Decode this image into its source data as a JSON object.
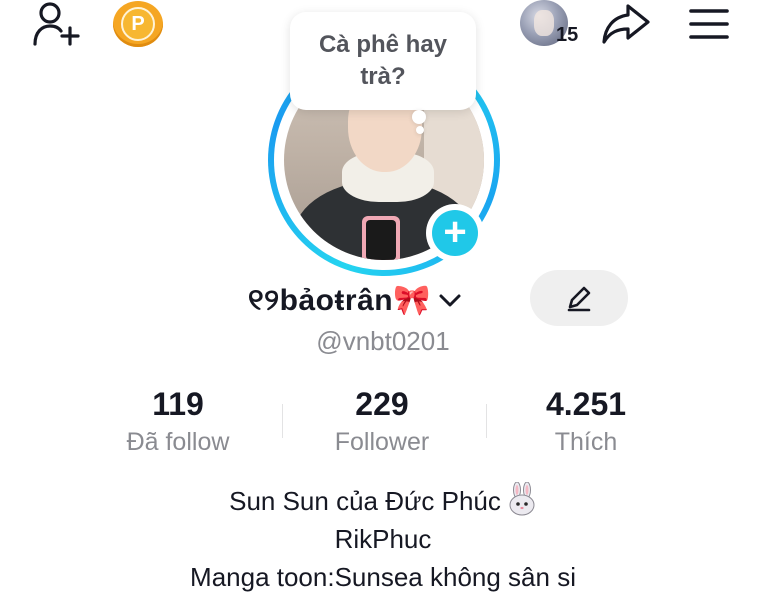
{
  "topbar": {
    "add_friend_icon": "add-user-icon",
    "points_label": "P",
    "visitor_count": "15",
    "share_icon": "share-arrow-icon",
    "menu_icon": "hamburger-menu-icon"
  },
  "note_bubble": {
    "line1": "Cà phê hay",
    "line2": "trà?"
  },
  "profile": {
    "display_name": "୧୨bảoŧrân🎀",
    "username": "@vnbt0201"
  },
  "stats": [
    {
      "value": "119",
      "label": "Đã follow"
    },
    {
      "value": "229",
      "label": "Follower"
    },
    {
      "value": "4.251",
      "label": "Thích"
    }
  ],
  "bio": {
    "line1": "Sun Sun của Đức Phúc",
    "line2": "RikPhuc",
    "line3": "Manga toon:Sunsea không sân si"
  },
  "colors": {
    "accent_cyan": "#20c8e8",
    "points_orange": "#f5a623",
    "text_primary": "#161823",
    "text_secondary": "#8a8b91"
  }
}
